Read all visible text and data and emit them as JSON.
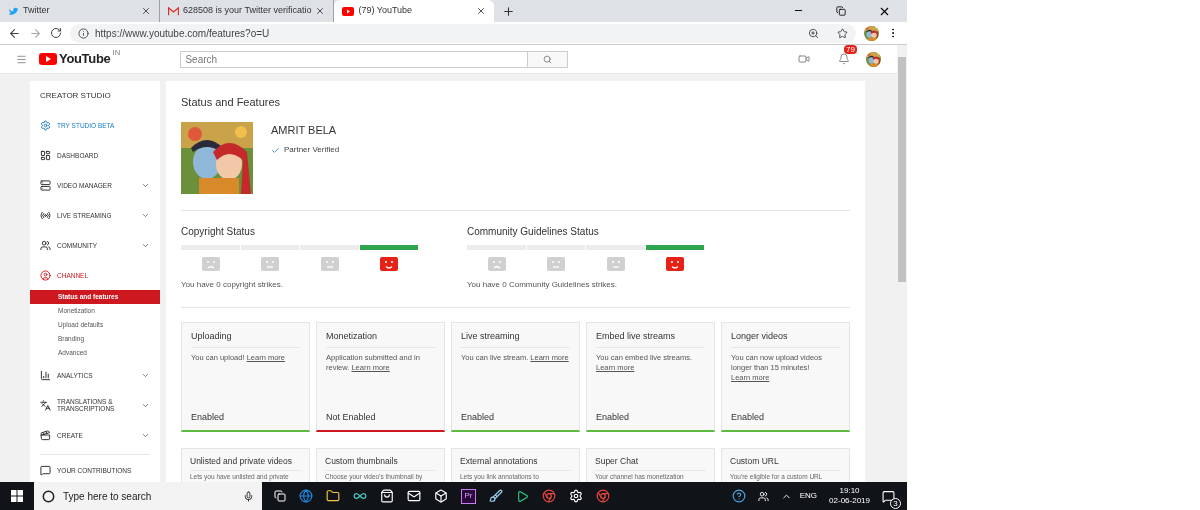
{
  "browser": {
    "tabs": [
      {
        "title": "Twitter",
        "selected": false
      },
      {
        "title": "628508 is your Twitter verificatio",
        "selected": false
      },
      {
        "title": "(79) YouTube",
        "selected": true
      }
    ],
    "url": "https://www.youtube.com/features?o=U"
  },
  "header": {
    "logo": "YouTube",
    "region": "IN",
    "search_placeholder": "Search",
    "notifications": "79"
  },
  "sidebar": {
    "title": "CREATOR STUDIO",
    "items": [
      {
        "label": "TRY STUDIO BETA",
        "selected": false,
        "expandable": false,
        "accent": true
      },
      {
        "label": "DASHBOARD",
        "selected": false,
        "expandable": false,
        "accent": false
      },
      {
        "label": "VIDEO MANAGER",
        "selected": false,
        "expandable": true,
        "accent": false
      },
      {
        "label": "LIVE STREAMING",
        "selected": false,
        "expandable": true,
        "accent": false
      },
      {
        "label": "COMMUNITY",
        "selected": false,
        "expandable": true,
        "accent": false
      },
      {
        "label": "CHANNEL",
        "selected": true,
        "expandable": false,
        "children": [
          {
            "label": "Status and features",
            "selected": true
          },
          {
            "label": "Monetization",
            "selected": false
          },
          {
            "label": "Upload defaults",
            "selected": false
          },
          {
            "label": "Branding",
            "selected": false
          },
          {
            "label": "Advanced",
            "selected": false
          }
        ]
      },
      {
        "label": "ANALYTICS",
        "selected": false,
        "expandable": true,
        "accent": false
      },
      {
        "label": "TRANSLATIONS & TRANSCRIPTIONS",
        "selected": false,
        "expandable": true,
        "accent": false
      },
      {
        "label": "CREATE",
        "selected": false,
        "expandable": true,
        "accent": false
      },
      {
        "label": "YOUR CONTRIBUTIONS",
        "selected": false,
        "expandable": false,
        "accent": false
      }
    ]
  },
  "main": {
    "title": "Status and Features",
    "channel": {
      "name": "AMRIT BELA",
      "badge": "Partner Verified"
    },
    "statuses": [
      {
        "title": "Copyright Status",
        "levels": [
          {
            "selected": false
          },
          {
            "selected": false
          },
          {
            "selected": false
          },
          {
            "selected": true
          }
        ],
        "message": "You have 0 copyright strikes."
      },
      {
        "title": "Community Guidelines Status",
        "levels": [
          {
            "selected": false
          },
          {
            "selected": false
          },
          {
            "selected": false
          },
          {
            "selected": true
          }
        ],
        "message": "You have 0 Community Guidelines strikes."
      }
    ],
    "features": [
      {
        "title": "Uploading",
        "description": "You can upload!",
        "link": "Learn more",
        "status": "Enabled",
        "enabled": true
      },
      {
        "title": "Monetization",
        "description": "Application submitted and in review.",
        "link": "Learn more",
        "status": "Not Enabled",
        "enabled": false
      },
      {
        "title": "Live streaming",
        "description": "You can live stream.",
        "link": "Learn more",
        "status": "Enabled",
        "enabled": true
      },
      {
        "title": "Embed live streams",
        "description": "You can embed live streams.",
        "link": "Learn more",
        "status": "Enabled",
        "enabled": true
      },
      {
        "title": "Longer videos",
        "description": "You can now upload videos longer than 15 minutes!",
        "link": "Learn more",
        "status": "Enabled",
        "enabled": true
      }
    ],
    "more_features": [
      {
        "title": "Unlisted and private videos",
        "description": "Lets you have unlisted and private"
      },
      {
        "title": "Custom thumbnails",
        "description": "Choose your video's thumbnail by"
      },
      {
        "title": "External annotations",
        "description": "Lets you link annotations to"
      },
      {
        "title": "Super Chat",
        "description": "Your channel has monetization"
      },
      {
        "title": "Custom URL",
        "description": "You're eligible for a custom URL"
      }
    ]
  },
  "taskbar": {
    "search_placeholder": "Type here to search",
    "app_label": "Pr",
    "language": "ENG",
    "time": "19:10",
    "date": "02-06-2019",
    "notification_count": "3"
  }
}
